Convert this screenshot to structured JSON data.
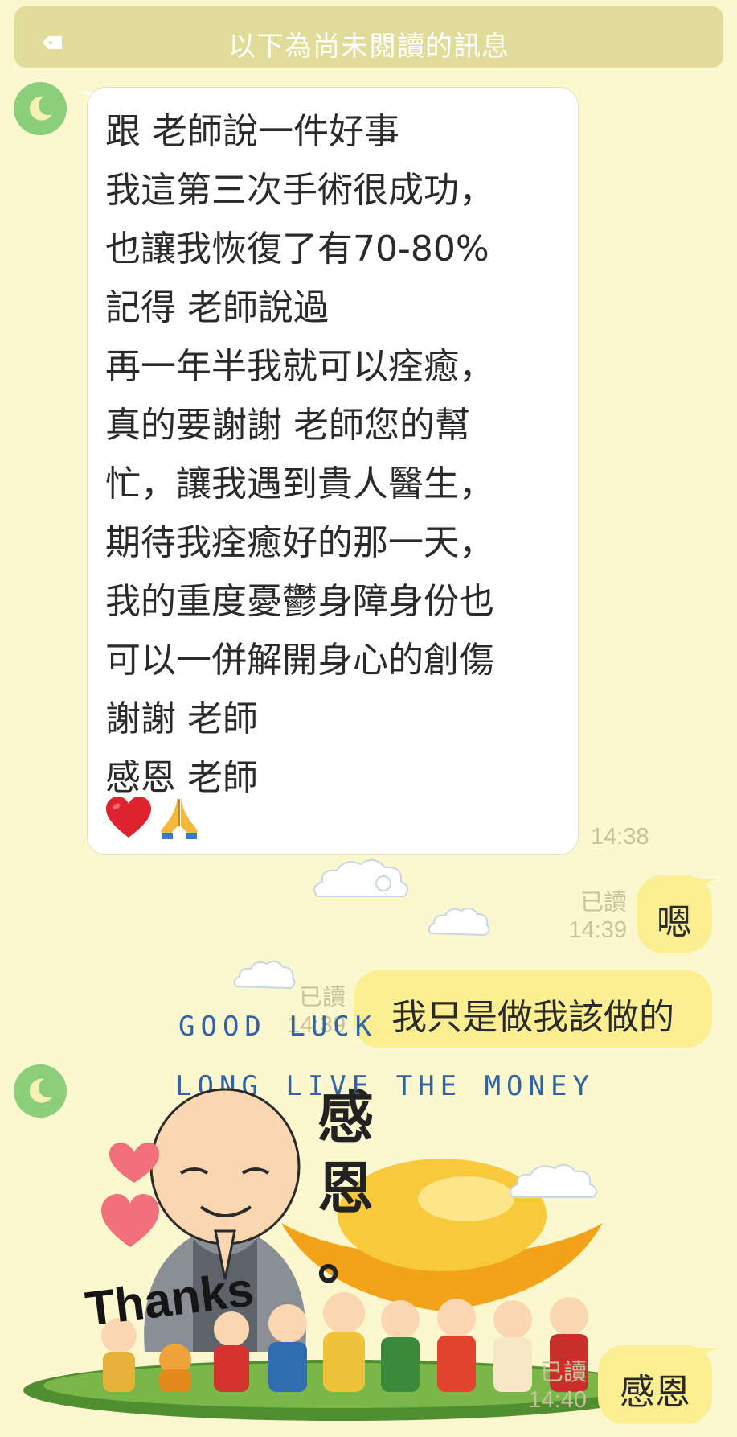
{
  "banner": {
    "text": "以下為尚未閱讀的訊息",
    "icon": "tag-icon"
  },
  "incoming_message": {
    "lines": [
      "跟  老師說一件好事",
      "我這第三次手術很成功，",
      "也讓我恢復了有70-80%",
      "記得 老師說過",
      "再一年半我就可以痊癒，",
      "真的要謝謝  老師您的幫",
      "忙，讓我遇到貴人醫生，",
      "期待我痊癒好的那一天，",
      "我的重度憂鬱身障身份也",
      "可以一併解開身心的創傷",
      "謝謝 老師",
      "感恩 老師"
    ],
    "emojis": [
      "heart-emoji",
      "folded-hands-emoji"
    ],
    "time": "14:38"
  },
  "outgoing_1": {
    "text": "嗯",
    "read": "已讀",
    "time": "14:39"
  },
  "outgoing_2": {
    "text": "我只是做我該做的",
    "read": "已讀",
    "time": "14:39"
  },
  "sticker": {
    "line1": "GOOD LUCK",
    "line2": "LONG LIVE THE MONEY",
    "vertical_text": [
      "感",
      "恩",
      "。"
    ],
    "thanks": "Thanks",
    "time": "14:40"
  },
  "outgoing_3": {
    "text": "感恩",
    "read": "已讀",
    "time": "14:40"
  },
  "colors": {
    "background": "#fbf7cf",
    "banner": "#e2dc9a",
    "out_bubble": "#fbef92",
    "in_bubble": "#ffffff",
    "avatar": "#8ccf7a",
    "meta_text": "#c7c39b"
  }
}
